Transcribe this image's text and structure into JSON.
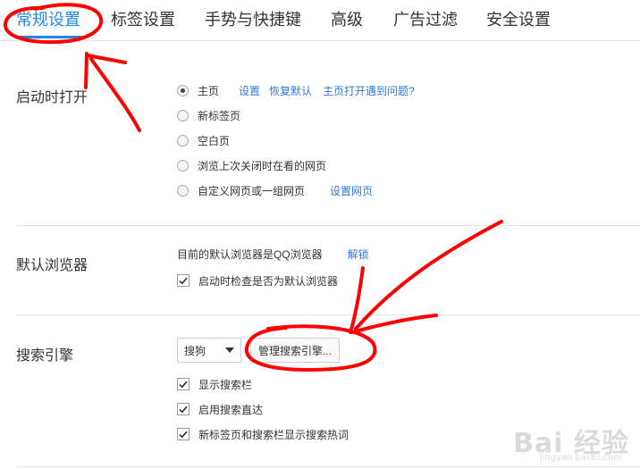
{
  "tabs": [
    {
      "label": "常规设置",
      "active": true
    },
    {
      "label": "标签设置",
      "active": false
    },
    {
      "label": "手势与快捷键",
      "active": false
    },
    {
      "label": "高级",
      "active": false
    },
    {
      "label": "广告过滤",
      "active": false
    },
    {
      "label": "安全设置",
      "active": false
    }
  ],
  "startup": {
    "title": "启动时打开",
    "options": [
      {
        "label": "主页",
        "checked": true
      },
      {
        "label": "新标签页",
        "checked": false
      },
      {
        "label": "空白页",
        "checked": false
      },
      {
        "label": "浏览上次关闭时在看的网页",
        "checked": false
      },
      {
        "label": "自定义网页或一组网页",
        "checked": false
      }
    ],
    "home_links": [
      "设置",
      "恢复默认",
      "主页打开遇到问题?"
    ],
    "custom_link": "设置网页"
  },
  "default_browser": {
    "title": "默认浏览器",
    "status_text": "目前的默认浏览器是QQ浏览器",
    "unlock_link": "解锁",
    "check_label": "启动时检查是否为默认浏览器",
    "check_checked": true
  },
  "search": {
    "title": "搜索引擎",
    "selected_engine": "搜狗",
    "manage_button": "管理搜索引擎...",
    "options": [
      {
        "label": "显示搜索栏",
        "checked": true
      },
      {
        "label": "启用搜索直达",
        "checked": true
      },
      {
        "label": "新标签页和搜索栏显示搜索热词",
        "checked": true
      }
    ]
  },
  "watermark": {
    "line1": "Bai 经验",
    "line2": "jingyan.baidu.com"
  },
  "colors": {
    "accent": "#1e88e5",
    "link": "#2f7bd8",
    "annotation": "#ff0000"
  }
}
